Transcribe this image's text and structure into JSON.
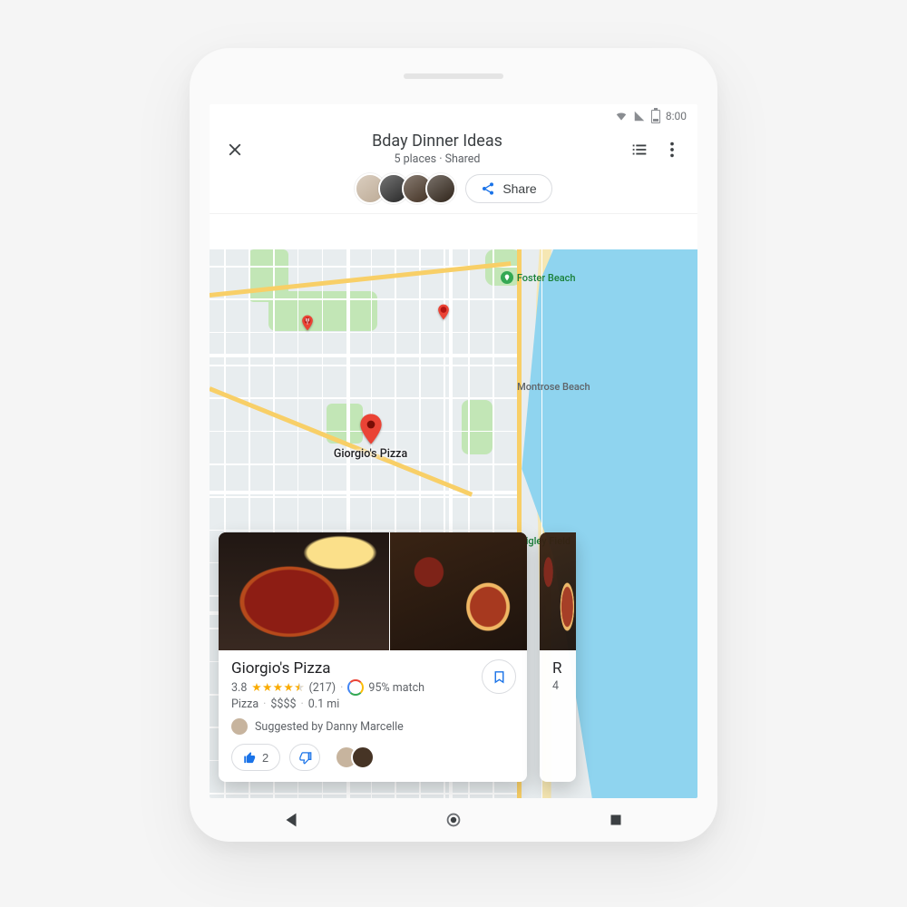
{
  "status": {
    "clock": "8:00"
  },
  "header": {
    "title": "Bday Dinner Ideas",
    "subtitle": "5 places · Shared",
    "share_label": "Share",
    "collaborators": [
      {
        "bg": "#c7b49e"
      },
      {
        "bg": "#2a2a2a"
      },
      {
        "bg": "#463425"
      },
      {
        "bg": "#32261b"
      }
    ]
  },
  "map": {
    "selected_pin_label": "Giorgio's Pizza",
    "poi": {
      "foster": "Foster Beach",
      "montrose": "Montrose Beach",
      "wrigley": "Wrigley Field"
    }
  },
  "card": {
    "name": "Giorgio's Pizza",
    "rating": "3.8",
    "stars": "★★★★",
    "half": "⯨",
    "reviews": "(217)",
    "match": "95% match",
    "category": "Pizza",
    "price": "$$$$",
    "distance": "0.1 mi",
    "suggested": "Suggested by Danny Marcelle",
    "up_count": "2"
  },
  "ghost_card": {
    "initial": "R",
    "line": "4"
  }
}
